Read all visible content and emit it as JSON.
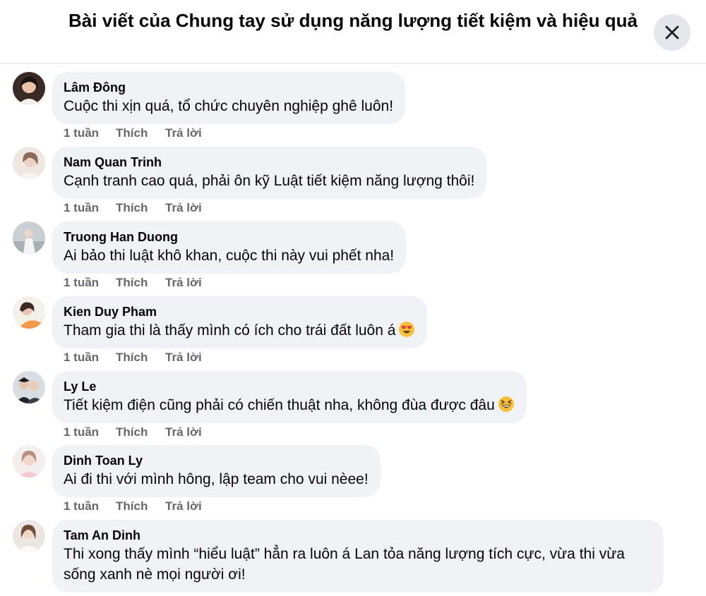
{
  "dialog": {
    "title": "Bài viết của Chung tay sử dụng năng lượng tiết kiệm và hiệu quả",
    "close_icon": "close-icon"
  },
  "comments": [
    {
      "author": "Lâm Đông",
      "text": "Cuộc thi xịn quá, tổ chức chuyên nghiệp ghê luôn!",
      "time": "1 tuần",
      "like": "Thích",
      "reply": "Trả lời"
    },
    {
      "author": "Nam Quan Trinh",
      "text": "Cạnh tranh cao quá, phải ôn kỹ Luật tiết kiệm năng lượng thôi!",
      "time": "1 tuần",
      "like": "Thích",
      "reply": "Trả lời"
    },
    {
      "author": "Truong Han Duong",
      "text": "Ai bảo thi luật khô khan, cuộc thi này vui phết nha!",
      "time": "1 tuần",
      "like": "Thích",
      "reply": "Trả lời"
    },
    {
      "author": "Kien Duy Pham",
      "text": "Tham gia thi là thấy mình có ích cho trái đất luôn á",
      "emoji": "heart-eyes-emoji",
      "time": "1 tuần",
      "like": "Thích",
      "reply": "Trả lời"
    },
    {
      "author": "Ly Le",
      "text": "Tiết kiệm điện cũng phải có chiến thuật nha, không đùa được đâu",
      "emoji": "grinning-squint-emoji",
      "time": "1 tuần",
      "like": "Thích",
      "reply": "Trả lời"
    },
    {
      "author": "Dinh Toan Ly",
      "text": "Ai đi thi với mình hông, lập team cho vui nèee!",
      "time": "1 tuần",
      "like": "Thích",
      "reply": "Trả lời"
    },
    {
      "author": "Tam An Dinh",
      "text": "Thi xong thấy mình “hiểu luật” hẳn ra luôn á Lan tỏa năng lượng tích cực, vừa thi vừa sống xanh nè mọi người ơi!"
    }
  ],
  "colors": {
    "bubble_bg": "#f0f2f5",
    "secondary_text": "#65676b",
    "close_button_bg": "#e4e6eb"
  }
}
